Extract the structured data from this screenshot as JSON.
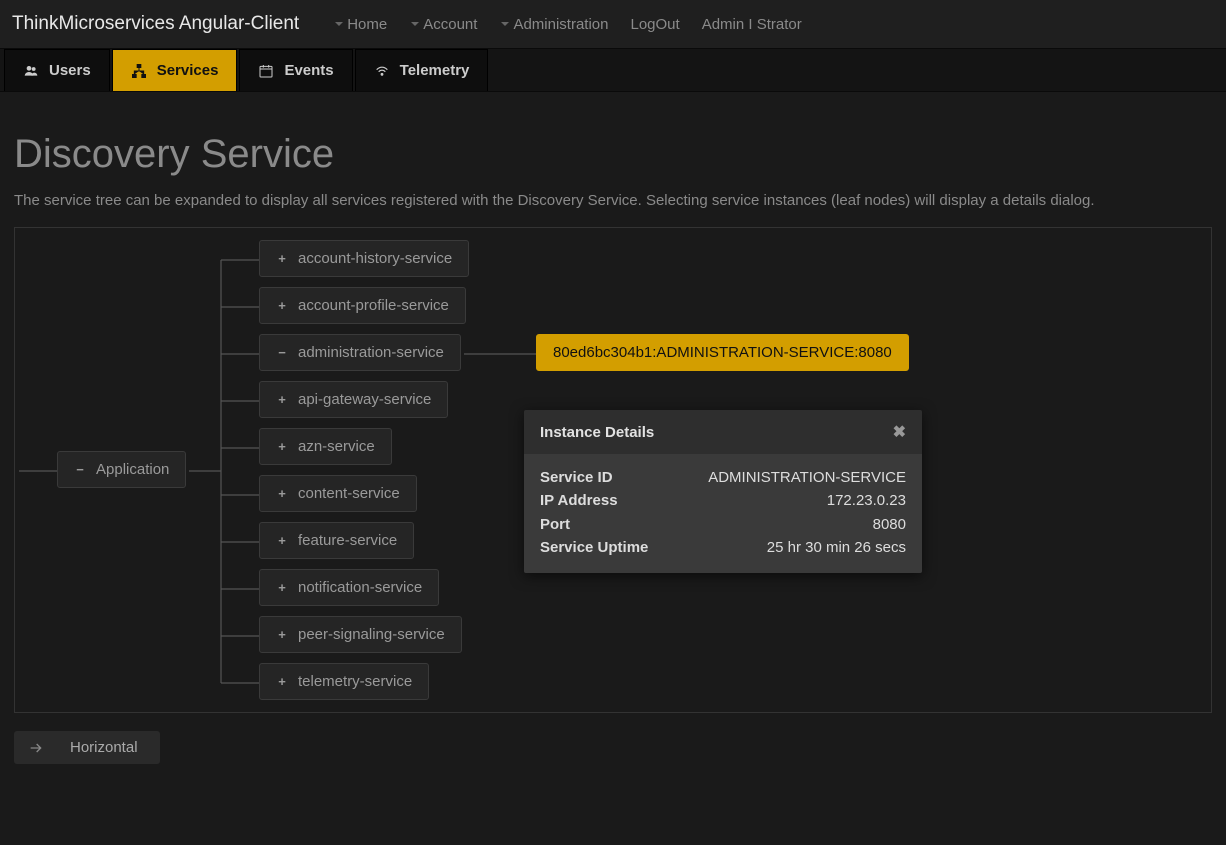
{
  "brand": "ThinkMicroservices Angular-Client",
  "nav": {
    "home": "Home",
    "account": "Account",
    "administration": "Administration",
    "logout": "LogOut",
    "username": "Admin I Strator"
  },
  "tabs": {
    "users": "Users",
    "services": "Services",
    "events": "Events",
    "telemetry": "Telemetry"
  },
  "page": {
    "title": "Discovery Service",
    "description": "The service tree can be expanded to display all services registered with the Discovery Service. Selecting service instances (leaf nodes) will display a details dialog."
  },
  "tree": {
    "root": "Application",
    "services": [
      "account-history-service",
      "account-profile-service",
      "administration-service",
      "api-gateway-service",
      "azn-service",
      "content-service",
      "feature-service",
      "notification-service",
      "peer-signaling-service",
      "telemetry-service"
    ],
    "expanded_service_index": 2,
    "instance_label": "80ed6bc304b1:ADMINISTRATION-SERVICE:8080"
  },
  "dialog": {
    "title": "Instance Details",
    "rows": {
      "service_id_k": "Service ID",
      "service_id_v": "ADMINISTRATION-SERVICE",
      "ip_k": "IP Address",
      "ip_v": "172.23.0.23",
      "port_k": "Port",
      "port_v": "8080",
      "uptime_k": "Service Uptime",
      "uptime_v": "25 hr 30 min 26 secs"
    }
  },
  "orientation_label": "Horizontal"
}
